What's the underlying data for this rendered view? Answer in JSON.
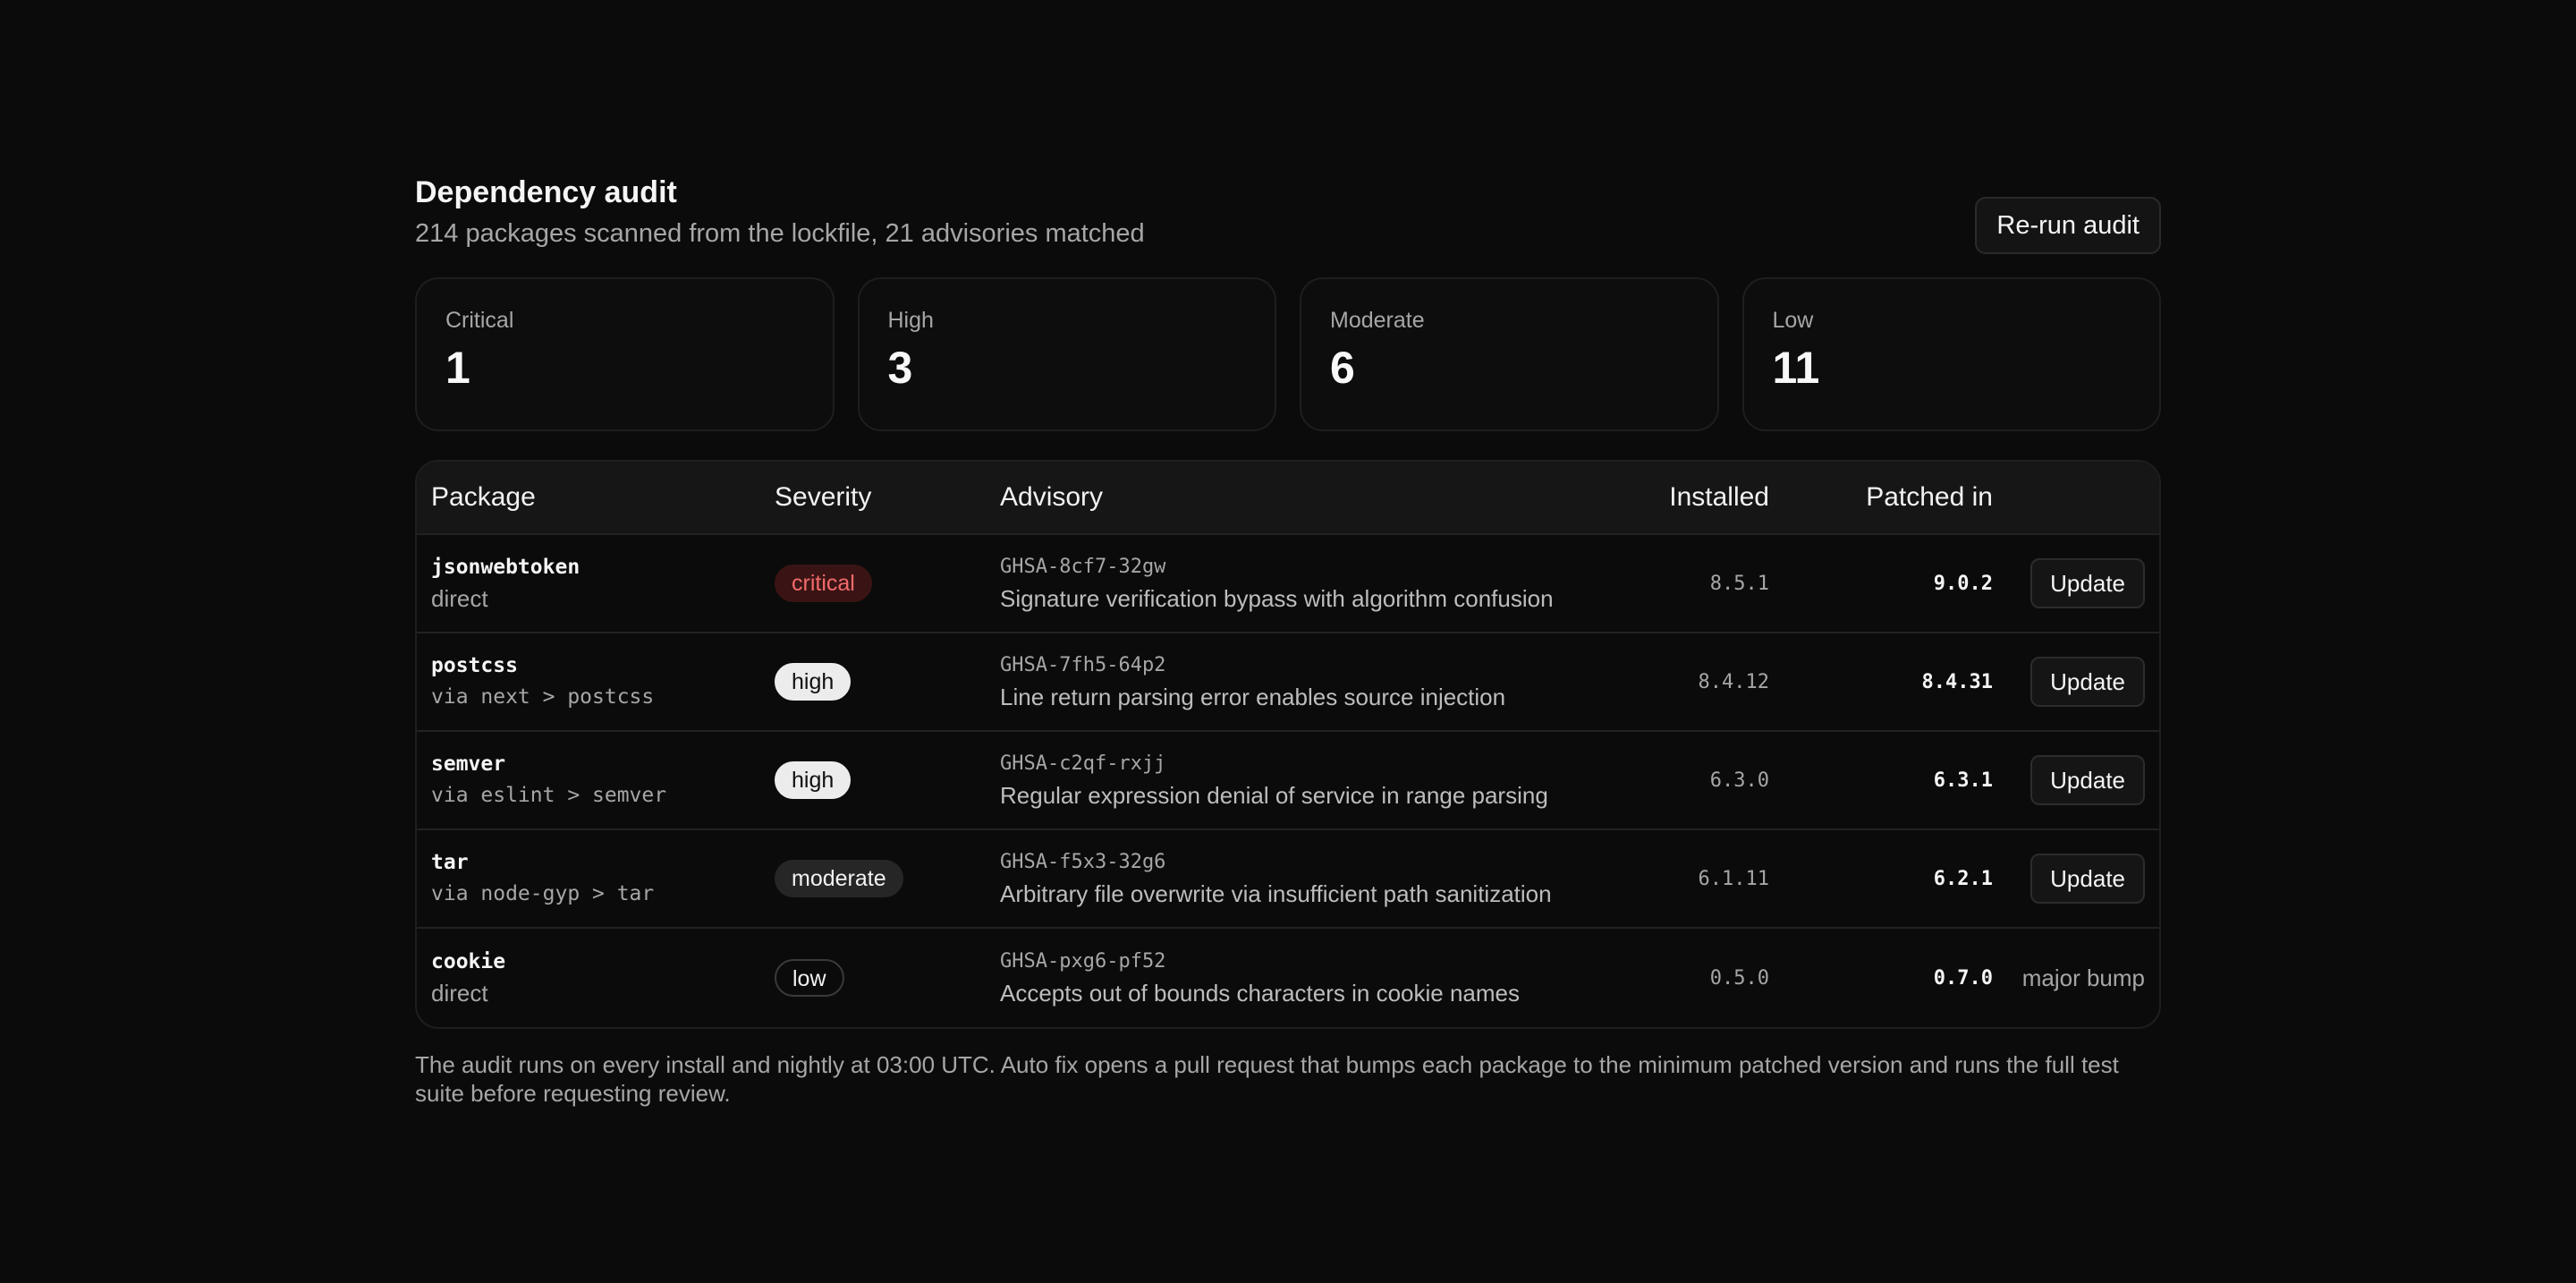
{
  "header": {
    "title": "Dependency audit",
    "subtitle": "214 packages scanned from the lockfile, 21 advisories matched",
    "rerun_label": "Re-run audit"
  },
  "summary": [
    {
      "label": "Critical",
      "value": "1"
    },
    {
      "label": "High",
      "value": "3"
    },
    {
      "label": "Moderate",
      "value": "6"
    },
    {
      "label": "Low",
      "value": "11"
    }
  ],
  "table": {
    "columns": [
      "Package",
      "Severity",
      "Advisory",
      "Installed",
      "Patched in"
    ],
    "rows": [
      {
        "name": "jsonwebtoken",
        "via": "direct",
        "severity": "critical",
        "advisory_id": "GHSA-8cf7-32gw",
        "advisory": "Signature verification bypass with algorithm confusion",
        "installed": "8.5.1",
        "patched": "9.0.2",
        "action": "Update"
      },
      {
        "name": "postcss",
        "via": "via next > postcss",
        "severity": "high",
        "advisory_id": "GHSA-7fh5-64p2",
        "advisory": "Line return parsing error enables source injection",
        "installed": "8.4.12",
        "patched": "8.4.31",
        "action": "Update"
      },
      {
        "name": "semver",
        "via": "via eslint > semver",
        "severity": "high",
        "advisory_id": "GHSA-c2qf-rxjj",
        "advisory": "Regular expression denial of service in range parsing",
        "installed": "6.3.0",
        "patched": "6.3.1",
        "action": "Update"
      },
      {
        "name": "tar",
        "via": "via node-gyp > tar",
        "severity": "moderate",
        "advisory_id": "GHSA-f5x3-32g6",
        "advisory": "Arbitrary file overwrite via insufficient path sanitization",
        "installed": "6.1.11",
        "patched": "6.2.1",
        "action": "Update"
      },
      {
        "name": "cookie",
        "via": "direct",
        "severity": "low",
        "advisory_id": "GHSA-pxg6-pf52",
        "advisory": "Accepts out of bounds characters in cookie names",
        "installed": "0.5.0",
        "patched": "0.7.0",
        "action": "major bump"
      }
    ]
  },
  "footnote": "The audit runs on every install and nightly at 03:00 UTC. Auto fix opens a pull request that bumps each package to the minimum patched version and runs the full test suite before requesting review.",
  "colors": {
    "background": "#0b0b0b",
    "critical": "#f36b6b",
    "critical_bg": "#3a1414",
    "high_bg": "#ececec",
    "moderate_bg": "#262626"
  }
}
